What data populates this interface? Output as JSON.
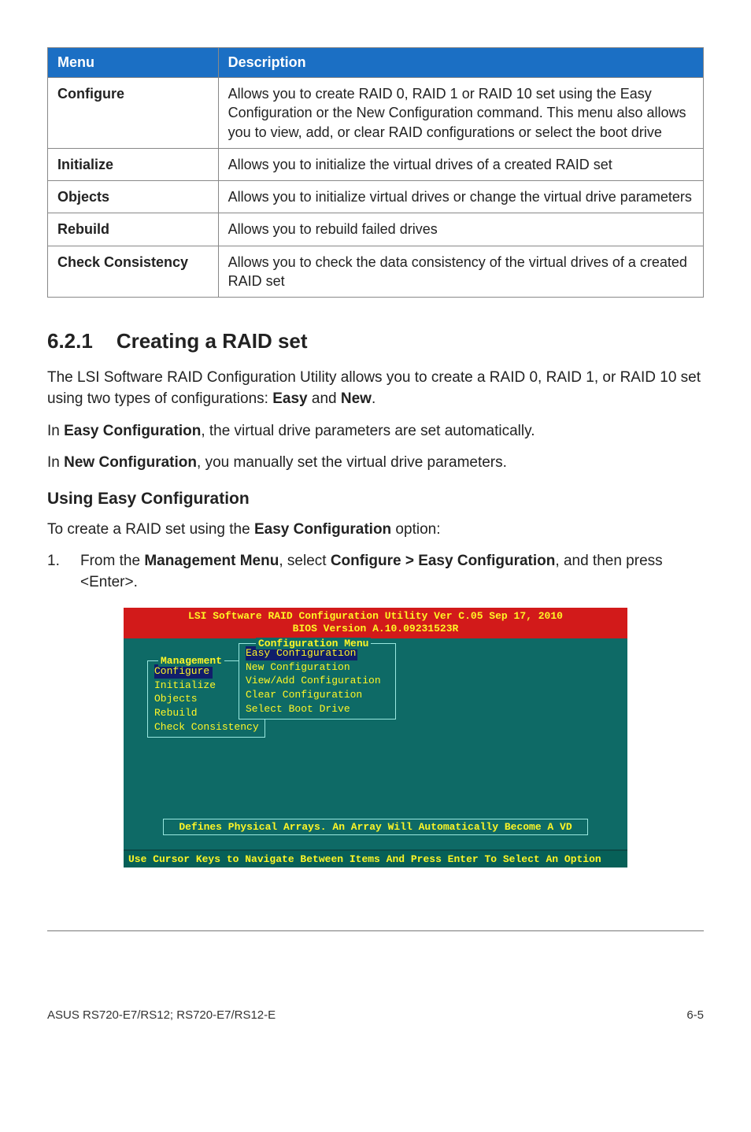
{
  "table": {
    "headers": {
      "menu": "Menu",
      "desc": "Description"
    },
    "rows": [
      {
        "menu": "Configure",
        "desc": "Allows you to create RAID 0, RAID 1 or RAID 10 set using the Easy Configuration or the New Configuration command. This menu also allows you to view, add, or clear RAID configurations or select the boot drive"
      },
      {
        "menu": "Initialize",
        "desc": "Allows you to initialize the virtual drives of a created RAID set"
      },
      {
        "menu": "Objects",
        "desc": "Allows you to initialize virtual drives or change the virtual drive parameters"
      },
      {
        "menu": "Rebuild",
        "desc": "Allows you to rebuild failed drives"
      },
      {
        "menu": "Check Consistency",
        "desc": "Allows you to check the data consistency of the virtual drives of a created RAID set"
      }
    ]
  },
  "section": {
    "number": "6.2.1",
    "title": "Creating a RAID set",
    "p1a": "The LSI Software RAID Configuration Utility allows you to create a RAID 0, RAID 1, or RAID 10 set using two types of configurations: ",
    "p1b_bold1": "Easy",
    "p1c": " and ",
    "p1d_bold2": "New",
    "p1e": ".",
    "p2a": "In ",
    "p2b_bold": "Easy Configuration",
    "p2c": ", the virtual drive parameters are set automatically.",
    "p3a": "In ",
    "p3b_bold": "New Configuration",
    "p3c": ", you manually set the virtual drive parameters."
  },
  "subsection": {
    "title": "Using Easy Configuration",
    "intro_a": "To create a RAID set using the ",
    "intro_b_bold": "Easy Configuration",
    "intro_c": " option:",
    "step1_num": "1.",
    "step1_a": "From the ",
    "step1_b_bold": "Management Menu",
    "step1_c": ", select ",
    "step1_d_bold": "Configure > Easy Configuration",
    "step1_e": ", and then press <Enter>."
  },
  "bios": {
    "header_line1": "LSI Software RAID Configuration Utility Ver C.05 Sep 17, 2010",
    "header_line2": "BIOS Version  A.10.09231523R",
    "mgmt_title": "Management",
    "mgmt_items": [
      "Configure",
      "Initialize",
      "Objects",
      "Rebuild",
      "Check Consistency"
    ],
    "cfg_title": "Configuration Menu",
    "cfg_items": [
      "Easy Configuration",
      "New Configuration",
      "View/Add Configuration",
      "Clear Configuration",
      "Select Boot Drive"
    ],
    "status": "Defines Physical Arrays. An Array Will Automatically Become A VD",
    "footer": "Use Cursor Keys to Navigate Between Items And Press Enter To Select An Option"
  },
  "footer": {
    "left": "ASUS RS720-E7/RS12; RS720-E7/RS12-E",
    "right": "6-5"
  }
}
